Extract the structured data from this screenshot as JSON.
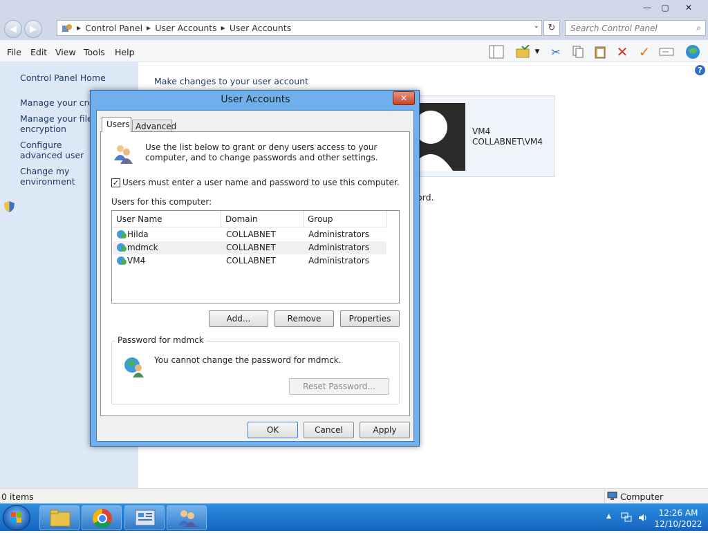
{
  "window": {
    "controls": {
      "minimize": "—",
      "maximize": "▢",
      "close": "✕"
    }
  },
  "address": {
    "crumbs": [
      "Control Panel",
      "User Accounts",
      "User Accounts"
    ],
    "search_placeholder": "Search Control Panel"
  },
  "menu": [
    "File",
    "Edit",
    "View",
    "Tools",
    "Help"
  ],
  "sidebar": {
    "home": "Control Panel Home",
    "items": [
      {
        "label": "Manage your credentials"
      },
      {
        "label": "Manage your file encryption certificates"
      },
      {
        "label": "Configure advanced user profile properties"
      },
      {
        "label": "Change my environment variables"
      }
    ]
  },
  "main": {
    "heading": "Make changes to your user account",
    "card": {
      "name": "VM4",
      "account": "COLLABNET\\VM4"
    },
    "partial_text": "ord."
  },
  "status": {
    "items": "0 items",
    "zone": "Computer"
  },
  "taskbar": {
    "time": "12:26 AM",
    "date": "12/10/2022"
  },
  "dialog": {
    "title": "User Accounts",
    "close": "✕",
    "tabs": [
      "Users",
      "Advanced"
    ],
    "intro": "Use the list below to grant or deny users access to your computer, and to change passwords and other settings.",
    "checkbox": {
      "label": "Users must enter a user name and password to use this computer.",
      "checked": true
    },
    "list_label": "Users for this computer:",
    "columns": [
      "User Name",
      "Domain",
      "Group"
    ],
    "users": [
      {
        "name": "Hilda",
        "domain": "COLLABNET",
        "group": "Administrators"
      },
      {
        "name": "mdmck",
        "domain": "COLLABNET",
        "group": "Administrators"
      },
      {
        "name": "VM4",
        "domain": "COLLABNET",
        "group": "Administrators"
      }
    ],
    "buttons": {
      "add": "Add...",
      "remove": "Remove",
      "properties": "Properties"
    },
    "password_group": {
      "legend": "Password for mdmck",
      "message": "You cannot change the password for mdmck.",
      "reset": "Reset Password..."
    },
    "footer": {
      "ok": "OK",
      "cancel": "Cancel",
      "apply": "Apply"
    }
  }
}
